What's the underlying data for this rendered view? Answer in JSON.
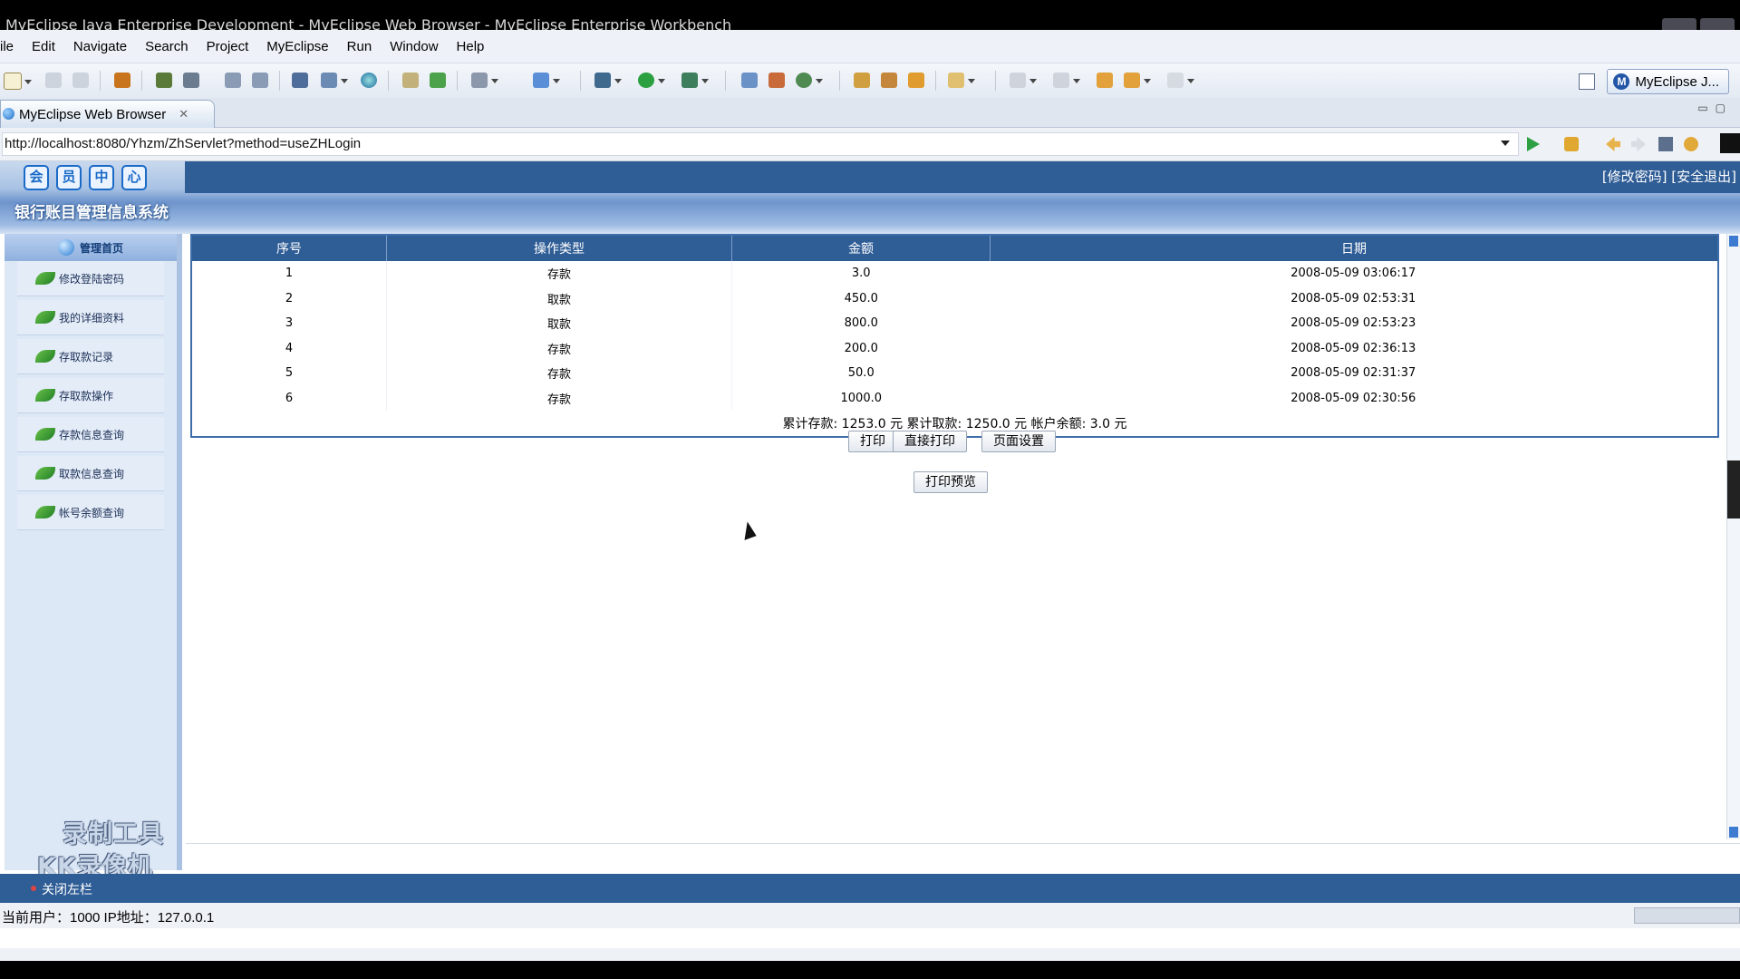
{
  "window": {
    "title": "MyEclipse Java Enterprise Development - MyEclipse Web Browser - MyEclipse Enterprise Workbench"
  },
  "menu": [
    "ile",
    "Edit",
    "Navigate",
    "Search",
    "Project",
    "MyEclipse",
    "Run",
    "Window",
    "Help"
  ],
  "perspective": {
    "label": "MyEclipse J...",
    "icon": "myeclipse-icon"
  },
  "tab": {
    "label": "MyEclipse Web Browser",
    "close": "✕"
  },
  "browser": {
    "url": "http://localhost:8080/Yhzm/ZhServlet?method=useZHLogin"
  },
  "site": {
    "logo_chars": [
      "会",
      "员",
      "中",
      "心"
    ],
    "header_links": "[修改密码] [安全退出]",
    "system_title": "银行账目管理信息系统",
    "nav_home": "管理首页",
    "nav_items": [
      "修改登陆密码",
      "我的详细资料",
      "存取款记录",
      "存取款操作",
      "存款信息查询",
      "取款信息查询",
      "帐号余额查询"
    ],
    "watermark_line1": "录制工具",
    "watermark_line2": "KK录像机"
  },
  "table": {
    "headers": [
      "序号",
      "操作类型",
      "金额",
      "日期"
    ],
    "rows": [
      [
        "1",
        "存款",
        "3.0",
        "2008-05-09 03:06:17"
      ],
      [
        "2",
        "取款",
        "450.0",
        "2008-05-09 02:53:31"
      ],
      [
        "3",
        "取款",
        "800.0",
        "2008-05-09 02:53:23"
      ],
      [
        "4",
        "存款",
        "200.0",
        "2008-05-09 02:36:13"
      ],
      [
        "5",
        "存款",
        "50.0",
        "2008-05-09 02:31:37"
      ],
      [
        "6",
        "存款",
        "1000.0",
        "2008-05-09 02:30:56"
      ]
    ],
    "summary": "累计存款: 1253.0 元 累计取款: 1250.0 元 帐户余额: 3.0 元"
  },
  "buttons": {
    "print": "打印",
    "direct_print": "直接打印",
    "page_setup": "页面设置",
    "print_preview": "打印预览"
  },
  "footer": {
    "close_left": "关闭左栏",
    "user_info": "当前用户：1000  IP地址：127.0.0.1"
  },
  "colors": {
    "header_blue": "#2f5d96",
    "nav_bg": "#dde8f6"
  }
}
